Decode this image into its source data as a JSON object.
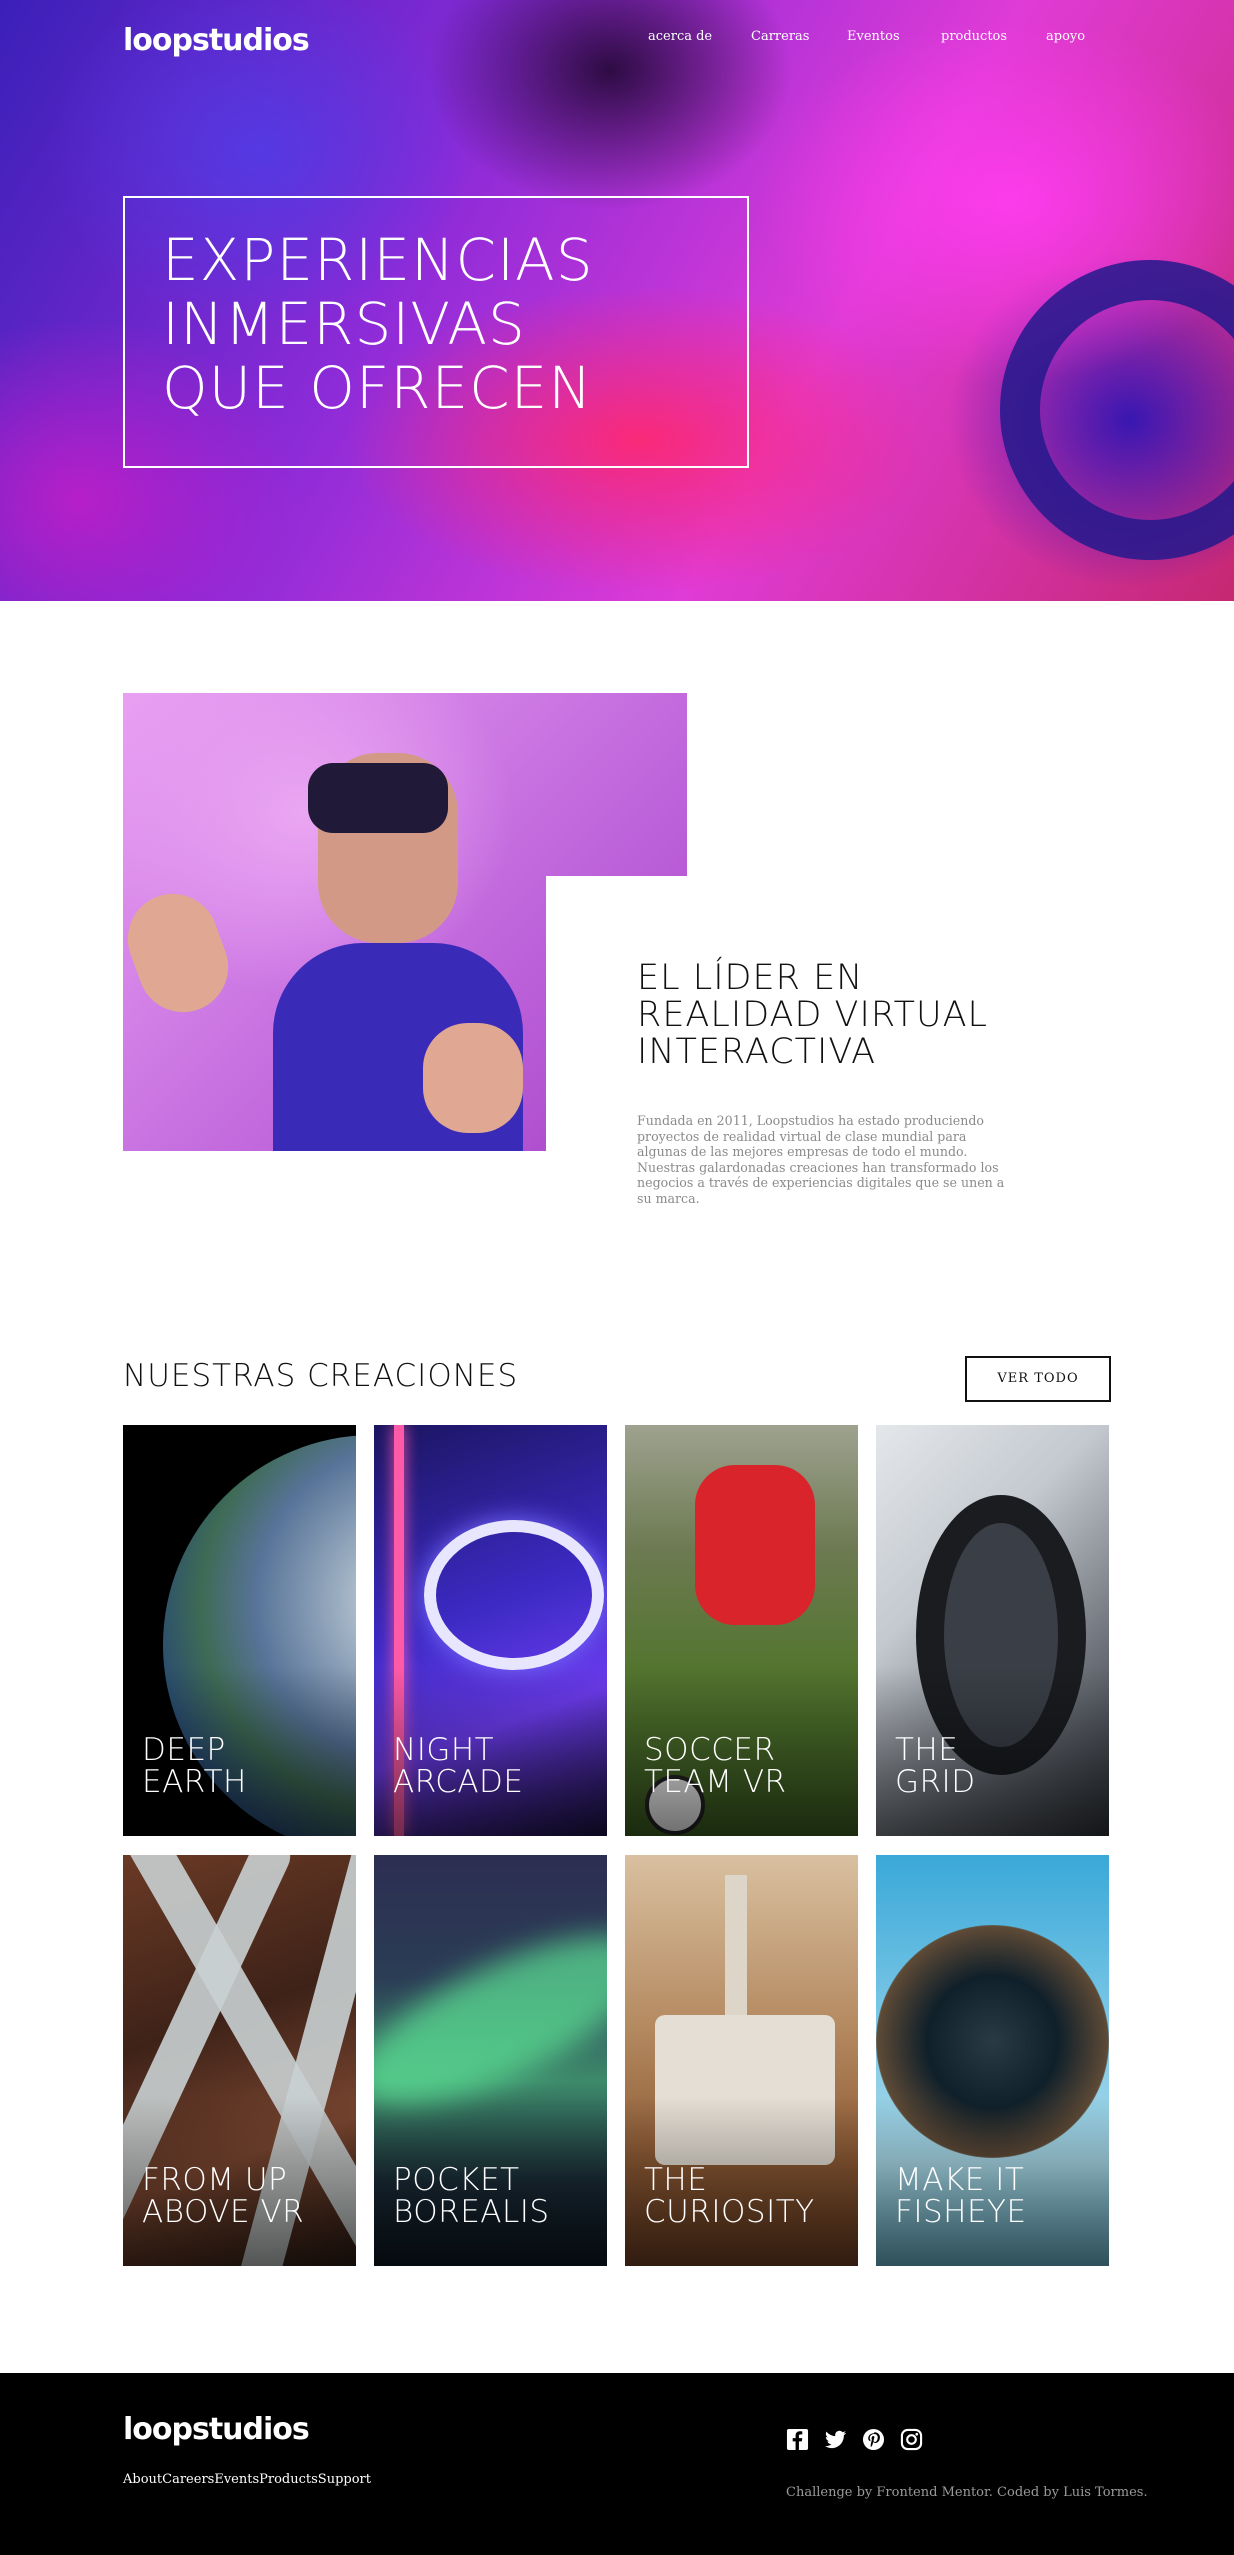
{
  "brand": {
    "logo": "loopstudios"
  },
  "nav": {
    "items": [
      {
        "label": "acerca de"
      },
      {
        "label": "Carreras"
      },
      {
        "label": "Eventos"
      },
      {
        "label": "productos"
      },
      {
        "label": "apoyo"
      }
    ]
  },
  "hero": {
    "title_lines": [
      "EXPERIENCIAS",
      "INMERSIVAS",
      "QUE OFRECEN"
    ]
  },
  "intro": {
    "title_lines": [
      "EL LÍDER EN",
      "REALIDAD VIRTUAL",
      "INTERACTIVA"
    ],
    "text": "Fundada en 2011, Loopstudios ha estado produciendo proyectos de realidad virtual de clase mundial para algunas de las mejores empresas de todo el mundo. Nuestras galardonadas creaciones han transformado los negocios a través de experiencias digitales que se unen a su marca."
  },
  "creations": {
    "title": "NUESTRAS CREACIONES",
    "see_all": "VER TODO",
    "items": [
      {
        "line1": "DEEP",
        "line2": "EARTH"
      },
      {
        "line1": "NIGHT",
        "line2": "ARCADE"
      },
      {
        "line1": "SOCCER",
        "line2": "TEAM VR"
      },
      {
        "line1": "THE",
        "line2": "GRID"
      },
      {
        "line1": "FROM UP",
        "line2": "ABOVE VR"
      },
      {
        "line1": "POCKET",
        "line2": "BOREALIS"
      },
      {
        "line1": "THE",
        "line2": "CURIOSITY"
      },
      {
        "line1": "MAKE IT",
        "line2": "FISHEYE"
      }
    ]
  },
  "footer": {
    "logo": "loopstudios",
    "nav": [
      "About",
      "Careers",
      "Events",
      "Products",
      "Support"
    ],
    "social_icons": [
      "facebook-icon",
      "twitter-icon",
      "pinterest-icon",
      "instagram-icon"
    ],
    "attribution": "Challenge by Frontend Mentor. Coded by Luis Tormes."
  },
  "colors": {
    "background": "#ffffff",
    "text_dark": "#111111",
    "text_muted": "#8a8a8a",
    "footer_bg": "#000000",
    "white": "#ffffff"
  }
}
